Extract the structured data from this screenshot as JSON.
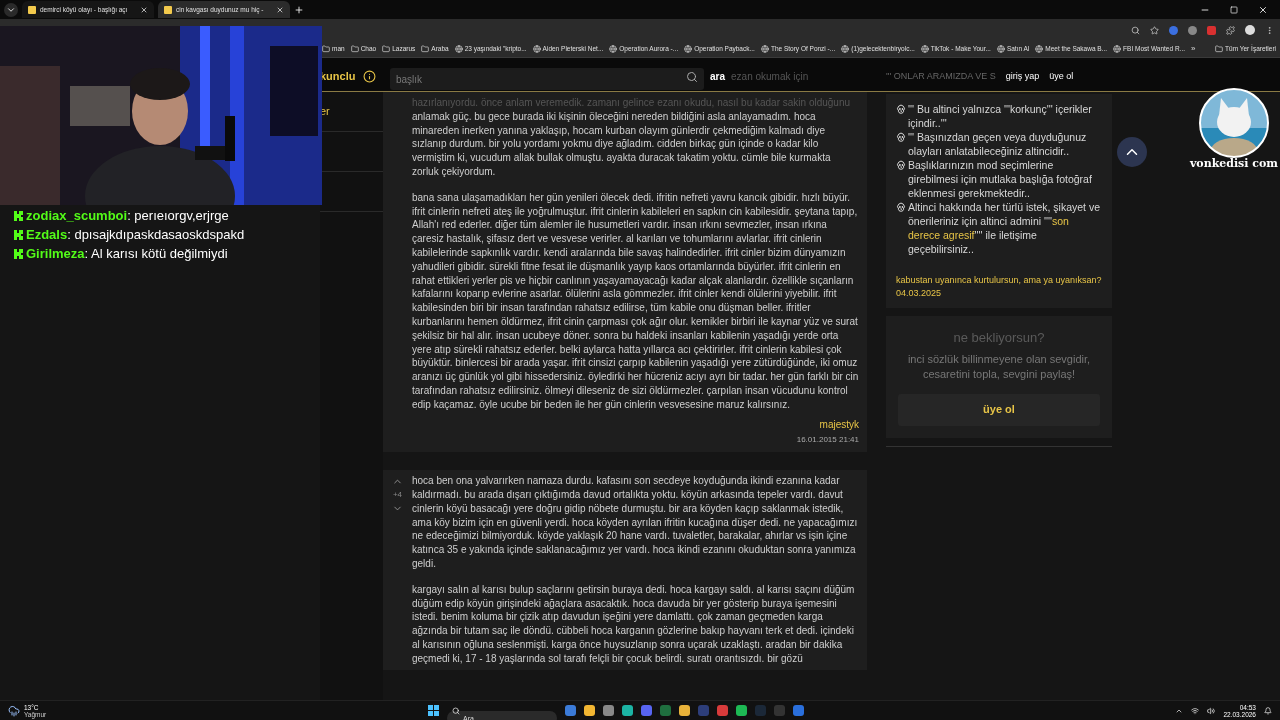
{
  "browser": {
    "tabs": [
      {
        "title": "demirci köyü olayı - başlığı açı",
        "selected": false
      },
      {
        "title": "cin kavgası duydunuz mu hiç -",
        "selected": true
      }
    ],
    "bookmarks": [
      {
        "label": "man"
      },
      {
        "label": "Chao"
      },
      {
        "label": "Lazarus"
      },
      {
        "label": "Araba"
      },
      {
        "label": "23 yaşındaki \"kripto..."
      },
      {
        "label": "Aiden Pleterski Net..."
      },
      {
        "label": "Operation Aurora -..."
      },
      {
        "label": "Operation Payback..."
      },
      {
        "label": "The Story Of Ponzi -..."
      },
      {
        "label": "(1)gelecektenbiryolc..."
      },
      {
        "label": "TikTok - Make Your..."
      },
      {
        "label": "Satın Al"
      },
      {
        "label": "Meet the Sakawa B..."
      },
      {
        "label": "FBI Most Wanted R..."
      }
    ],
    "overflow": "»",
    "all_bookmarks": "Tüm Yer İşaretleri"
  },
  "stream": {
    "chat": [
      {
        "user": "zodiax_scumboi",
        "message": ": perıeıorgv,erjrge"
      },
      {
        "user": "Ezdals",
        "message": ": dpısajkdıpaskdasaoskdspakd"
      },
      {
        "user": "Girilmeza",
        "message": ": Al karısı kötü değilmiydi"
      }
    ],
    "avatar_caption": "vonkedisi com"
  },
  "site": {
    "logo": "kunclu",
    "search": {
      "placeholder": "başlık"
    },
    "search_button": "ara",
    "behind_header": "ezan okumak için",
    "login": "giriş yap",
    "signup": "üye ol",
    "nav": [
      {
        "label": "er"
      }
    ],
    "entries": [
      {
        "faded_line": "hazırlanıyordu. önce anlam veremedik. zamanı gelince ezanı okudu, nasıl bu kadar sakin olduğunu",
        "paragraphs": [
          "anlamak güç. bu gece burada iki kişinin öleceğini nereden bildiğini asla anlayamadım. hoca minareden inerken yanına yaklaşıp, hocam kurban olayım günlerdir çekmediğim kalmadı diye sızlanıp durdum. bir yolu yordamı yokmu diye ağladım. cidden birkaç gün içinde o kadar kilo vermiştim ki, vucudum allak bullak olmuştu. ayakta duracak takatim yoktu. cümle bile kurmakta zorluk çekiyordum.",
          "bana sana ulaşamadıkları her gün yenileri ölecek dedi. ifritin nefreti yavru kancık gibidir. hızlı büyür. ifrit cinlerin nefreti ateş ile yoğrulmuştur. ifrit cinlerin kabileleri en sapkın cin kabilesidir. şeytana tapıp, Allah'ı red ederler. diğer tüm alemler ile husumetleri vardır. insan ırkını sevmezler, insan ırkına çaresiz hastalık, şifasız dert ve vesvese verirler. al karıları ve tohumlarını avlarlar. ifrit cinlerin kabilelerinde sapkınlık vardır. kendi aralarında bile savaş halindedirler. ifrit cinler bizim dünyamızın yahudileri gibidir. sürekli fitne fesat ile düşmanlık yayıp kaos ortamlarında büyürler. ifrit cinlerin en rahat ettikleri yerler pis ve hiçbir canlının yaşayamayacağı kadar alçak alanlardır. özellikle sıçanların kafalarını koparıp evlerine asarlar. ölülerini asla gömmezler. ifrit cinler kendi ölülerini yiyebilir. ifrit kabilesinden biri bir insan tarafından rahatsız edilirse, tüm kabile onu düşman beller. ifritler kurbanlarını hemen öldürmez, ifrit cinin çarpması çok ağır olur. kemikler birbiri ile kaynar yüz ve surat şekilsiz bir hal alır. insan ucubeye döner. sonra bu haldeki insanları kabilenin yaşadığı yerde orta yere atıp sürekli rahatsız ederler. belki aylarca hatta yıllarca acı çektirirler. ifrit cinlerin kabilesi çok büyüktür. binlercesi bir arada yaşar. ifrit cinsizi çarpıp kabilenin yaşadığı yere zütürdüğünde, iki omuz aranızı üç günlük yol gibi hissedersiniz. öyledirki her hücreniz acıyı ayrı bir tadar. her gün farklı bir cin tarafından rahatsız edilirsiniz. ölmeyi dileseniz de sizi öldürmezler. çarpılan insan vücudunu kontrol edip kaçamaz. öyle ucube bir beden ile her gün cinlerin vesvesesine maruz kalırsınız."
        ],
        "author": "majestyk",
        "date": "16.01.2015 21:41"
      },
      {
        "votes": "+4",
        "paragraphs": [
          "hoca ben ona yalvarırken namaza durdu. kafasını son secdeye koyduğunda ikindi ezanına kadar kaldırmadı. bu arada dışarı çıktığımda davud ortalıkta yoktu. köyün arkasında tepeler vardı. davut cinlerin köyü basacağı yere doğru gidip nöbete durmuştu. bir ara köyden kaçıp saklanmak istedik, ama köy bizim için en güvenli yerdi. hoca köyden ayrılan ifritin kucağına düşer dedi. ne yapacağımızı ne edeceğimizi bilmiyorduk. köyde yaklaşık 20 hane vardı. tuvaletler, barakalar, ahırlar vs işin içine katınca 35 e yakında içinde saklanacağımız yer vardı. hoca ikindi ezanını okuduktan sonra yanımıza geldi.",
          "kargayı salın al karısı bulup saçlarını getirsin buraya dedi. hoca kargayı saldı. al karısı saçını düğüm düğüm edip köyün girişindeki ağaçlara asacaktık. hoca davuda bir yer gösterip buraya işemesini istedi. benim koluma bir çizik atıp davudun işeğini yere damlattı. çok zaman geçmeden karga ağzında bir tutam saç ile döndü. cübbeli hoca karganın gözlerine bakıp hayvanı terk et dedi. içindeki al karısının oğluna seslenmişti. karga önce huysuzlanıp sonra uçarak uzaklaştı. aradan bir dakika geçmedi ki, 17 - 18 yaşlarında sol tarafı felçli bir çocuk belirdi. suratı orantısızdı. bir gözü"
        ]
      }
    ],
    "sidebar": {
      "title": "''' ONLAR ARAMIZDA VE S",
      "rules": [
        {
          "segments": [
            {
              "text": "''' Bu altinci yalnızca '''korkunç''' içerikler içindir..'''",
              "highlight": false
            }
          ]
        },
        {
          "segments": [
            {
              "text": "''' Başınızdan geçen veya duyduğunuz olayları anlatabileceğiniz altincidir..",
              "highlight": false
            }
          ]
        },
        {
          "segments": [
            {
              "text": "Başlıklarınızın mod seçimlerine girebilmesi için mutlaka başlığa fotoğraf eklenmesi gerekmektedir..",
              "highlight": false
            }
          ]
        },
        {
          "segments": [
            {
              "text": "Altinci hakkında her türlü istek, şikayet ve önerileriniz için altinci admini ''''",
              "highlight": false
            },
            {
              "text": "son derece agresif",
              "highlight": true
            },
            {
              "text": "'''' ile iletişime geçebilirsiniz..",
              "highlight": false
            }
          ]
        }
      ],
      "motto": "kabustan uyanınca kurtulursun, ama ya uyanıksan? 04.03.2025",
      "cta": {
        "title": "ne bekliyorsun?",
        "text": "inci sözlük billinmeyene olan sevgidir, cesaretini topla, sevgini paylaş!",
        "button": "üye ol"
      }
    }
  },
  "taskbar": {
    "weather": {
      "temp": "13°C",
      "condition": "Yağmur"
    },
    "search": {
      "placeholder": "Ara"
    },
    "time": "04:53",
    "date": "22.03.2026"
  }
}
